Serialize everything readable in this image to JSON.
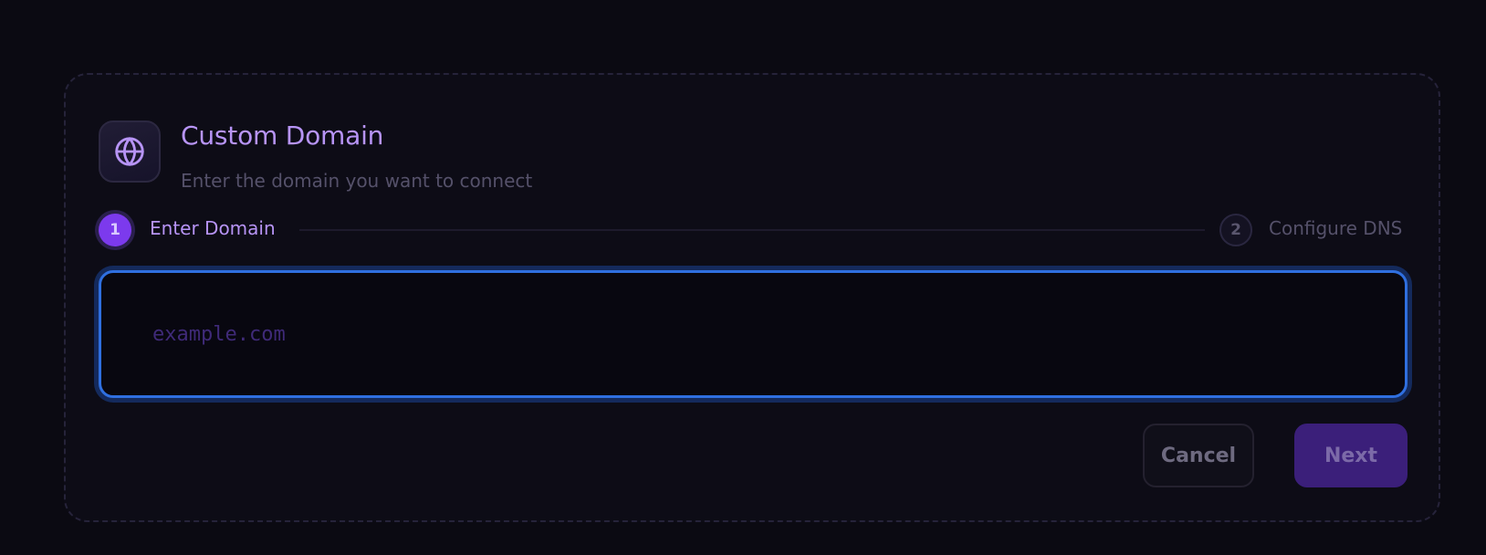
{
  "header": {
    "icon": "globe-icon",
    "title": "Custom Domain",
    "subtitle": "Enter the domain you want to connect"
  },
  "stepper": {
    "steps": [
      {
        "number": "1",
        "label": "Enter Domain",
        "state": "active"
      },
      {
        "number": "2",
        "label": "Configure DNS",
        "state": "pending"
      }
    ]
  },
  "domain_input": {
    "value": "",
    "placeholder": "example.com"
  },
  "actions": {
    "cancel_label": "Cancel",
    "next_label": "Next"
  },
  "colors": {
    "accent": "#7c3aed",
    "accent_text": "#b794f6",
    "focus_ring": "#2f6fe0",
    "background": "#0b0a12"
  }
}
